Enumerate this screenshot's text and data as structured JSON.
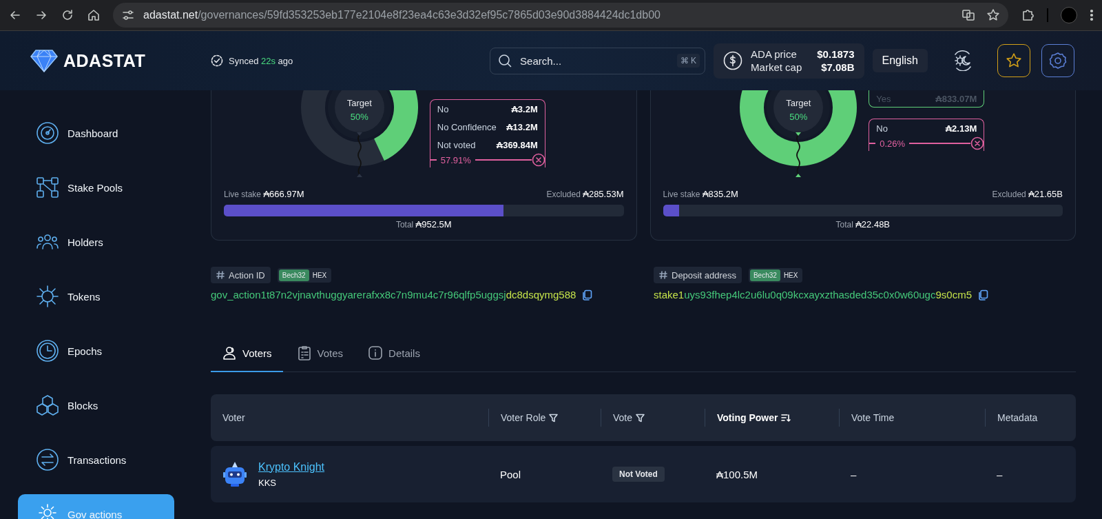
{
  "browser": {
    "url_host": "adastat.net",
    "url_path": "/governances/59fd353253eb177e2104e8f23ea4c63e3d32ef95c7865d03e90d3884424dc1db00"
  },
  "header": {
    "logo": "ADASTAT",
    "sync": {
      "label": "Synced",
      "age": "22s",
      "suffix": "ago"
    },
    "search": {
      "placeholder": "Search...",
      "shortcut": "⌘ K"
    },
    "price": [
      {
        "label": "ADA price",
        "value": "$0.1873"
      },
      {
        "label": "Market cap",
        "value": "$7.08B"
      }
    ],
    "language": "English"
  },
  "sidebar": {
    "items": [
      {
        "label": "Dashboard",
        "selected": false
      },
      {
        "label": "Stake Pools",
        "selected": false
      },
      {
        "label": "Holders",
        "selected": false
      },
      {
        "label": "Tokens",
        "selected": false
      },
      {
        "label": "Epochs",
        "selected": false
      },
      {
        "label": "Blocks",
        "selected": false
      },
      {
        "label": "Transactions",
        "selected": false
      },
      {
        "label": "Gov actions",
        "selected": true
      }
    ]
  },
  "cards": [
    {
      "target": {
        "label": "Target",
        "value": "50%"
      },
      "legend": [
        {
          "kind": "no",
          "rows": [
            {
              "label": "No",
              "value": "₳3.2M"
            },
            {
              "label": "No Confidence",
              "value": "₳13.2M"
            },
            {
              "label": "Not voted",
              "value": "₳369.84M"
            }
          ],
          "percent": "57.91%"
        }
      ],
      "live": {
        "label": "Live stake",
        "value": "₳666.97M"
      },
      "excluded": {
        "label": "Excluded",
        "value": "₳285.53M"
      },
      "level": 0.7,
      "total": {
        "label": "Total",
        "value": "₳952.5M"
      }
    },
    {
      "target": {
        "label": "Target",
        "value": "50%"
      },
      "legend": [
        {
          "kind": "yes",
          "rows": [
            {
              "label": "Yes",
              "value": "₳833.07M"
            }
          ]
        },
        {
          "kind": "no",
          "rows": [
            {
              "label": "No",
              "value": "₳2.13M"
            }
          ],
          "percent": "0.26%"
        }
      ],
      "live": {
        "label": "Live stake",
        "value": "₳835.2M"
      },
      "excluded": {
        "label": "Excluded",
        "value": "₳21.65B"
      },
      "level": 0.04,
      "total": {
        "label": "Total",
        "value": "₳22.48B"
      }
    }
  ],
  "ids": [
    {
      "label": "Action ID",
      "formats": [
        {
          "label": "Bech32",
          "selected": true
        },
        {
          "label": "HEX",
          "selected": false
        }
      ],
      "value_parts": [
        {
          "text": "gov_action1t87n2vjnavthuggyarerafxx8c7n9mu4c7r96qlfp5uggsj",
          "kind": "plain"
        },
        {
          "text": "dc8dsqymg588",
          "kind": "accent"
        }
      ]
    },
    {
      "label": "Deposit address",
      "formats": [
        {
          "label": "Bech32",
          "selected": true
        },
        {
          "label": "HEX",
          "selected": false
        }
      ],
      "value_parts": [
        {
          "text": "stake1",
          "kind": "accent"
        },
        {
          "text": "uys93fhep4lc2u6lu0q09kcxayxzthasded35c0x0w60ugc",
          "kind": "plain"
        },
        {
          "text": "9s0cm5",
          "kind": "accent"
        }
      ]
    }
  ],
  "tabs": [
    {
      "label": "Voters",
      "selected": true
    },
    {
      "label": "Votes",
      "selected": false
    },
    {
      "label": "Details",
      "selected": false
    }
  ],
  "table": {
    "columns": [
      {
        "label": "Voter",
        "kind": "plain",
        "sorted": false
      },
      {
        "label": "Voter Role",
        "kind": "filter",
        "sorted": false
      },
      {
        "label": "Vote",
        "kind": "filter",
        "sorted": false
      },
      {
        "label": "Voting Power",
        "kind": "sort",
        "sorted": true
      },
      {
        "label": "Vote Time",
        "kind": "plain",
        "sorted": false
      },
      {
        "label": "Metadata",
        "kind": "plain",
        "sorted": false
      }
    ],
    "rows": [
      {
        "name": "Krypto Knight",
        "ticker": "KKS",
        "role": "Pool",
        "vote": "Not Voted",
        "voting_power": "₳100.5M",
        "vote_time": "–",
        "metadata": "–"
      }
    ]
  }
}
